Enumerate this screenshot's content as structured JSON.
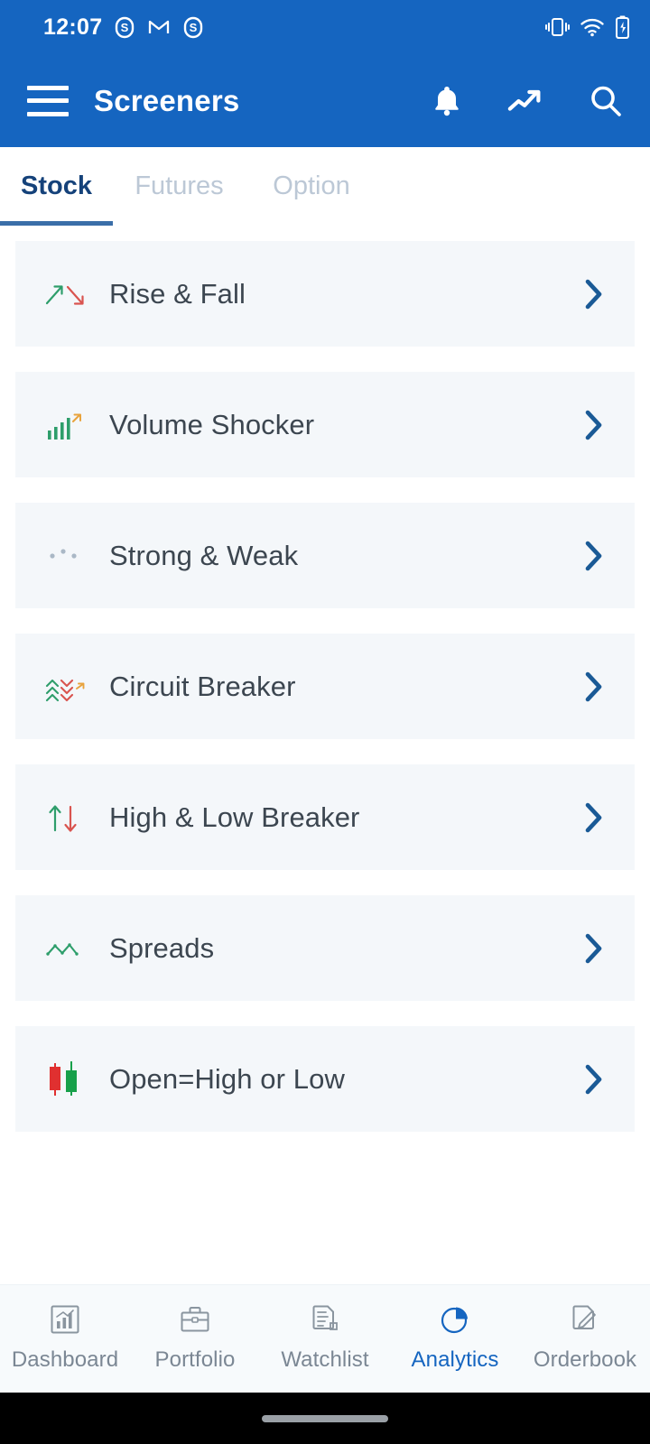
{
  "status_bar": {
    "time": "12:07",
    "left_icons": [
      {
        "name": "skype-notification-icon",
        "glyph": "S"
      },
      {
        "name": "gmail-icon",
        "glyph": "M"
      },
      {
        "name": "skype-notification-icon-2",
        "glyph": "S"
      }
    ],
    "right_icons": [
      {
        "name": "vibrate-mode-icon"
      },
      {
        "name": "wifi-icon"
      },
      {
        "name": "battery-charging-icon"
      }
    ]
  },
  "app_bar": {
    "title": "Screeners",
    "menu_icon": "hamburger-menu-icon",
    "actions": [
      {
        "name": "notifications-bell-icon"
      },
      {
        "name": "trending-up-icon"
      },
      {
        "name": "search-icon"
      }
    ]
  },
  "tabs": {
    "active_index": 0,
    "items": [
      {
        "label": "Stock",
        "active": true
      },
      {
        "label": "Futures",
        "active": false
      },
      {
        "label": "Option",
        "active": false
      }
    ]
  },
  "screeners": [
    {
      "label": "Rise & Fall",
      "icon": "rise-fall-arrows-icon"
    },
    {
      "label": "Volume Shocker",
      "icon": "volume-bars-icon"
    },
    {
      "label": "Strong & Weak",
      "icon": "strong-weak-dots-icon"
    },
    {
      "label": "Circuit Breaker",
      "icon": "circuit-chevrons-icon"
    },
    {
      "label": "High & Low Breaker",
      "icon": "high-low-arrows-icon"
    },
    {
      "label": "Spreads",
      "icon": "spreads-zigzag-icon"
    },
    {
      "label": "Open=High or Low",
      "icon": "candlestick-icon"
    }
  ],
  "bottom_nav": {
    "active_index": 3,
    "items": [
      {
        "label": "Dashboard",
        "icon": "dashboard-chart-icon"
      },
      {
        "label": "Portfolio",
        "icon": "briefcase-icon"
      },
      {
        "label": "Watchlist",
        "icon": "document-list-icon"
      },
      {
        "label": "Analytics",
        "icon": "pie-chart-icon"
      },
      {
        "label": "Orderbook",
        "icon": "document-pen-icon"
      }
    ]
  },
  "colors": {
    "brand_blue": "#1565C0",
    "card_bg": "#f4f7fa",
    "chevron_blue": "#1a5a96",
    "accent_green": "#2e9e6b",
    "accent_red": "#d9544f",
    "tab_active": "#15427a",
    "tab_inactive": "#bcc8d6"
  }
}
